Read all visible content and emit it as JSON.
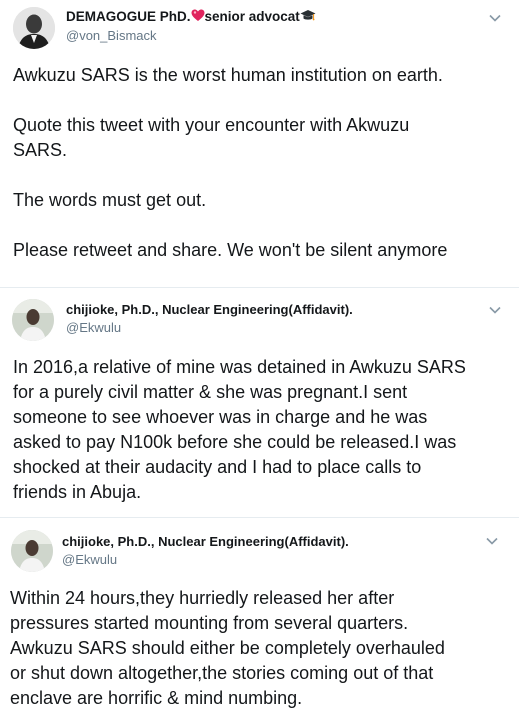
{
  "tweets": [
    {
      "display_name": "DEMAGOGUE PhD.",
      "display_name_suffix": "senior advocat",
      "name_emojis": [
        "heart-icon",
        "graduation-cap-icon"
      ],
      "handle": "@von_Bismack",
      "paragraphs": [
        "Awkuzu SARS is the worst human institution on earth.",
        "Quote this tweet with your encounter with Akwuzu SARS.",
        "The words must get out.",
        "Please retweet and share. We won't be silent anymore"
      ]
    },
    {
      "display_name": "chijioke, Ph.D., Nuclear Engineering(Affidavit).",
      "handle": "@Ekwulu",
      "lines": [
        "In 2016,a relative of mine was detained in Awkuzu SARS",
        "for a purely civil matter & she was pregnant.I sent",
        "someone to see whoever was in charge and he was",
        "asked to pay N100k before she could be released.I was",
        "shocked at their audacity and I had to place calls to",
        "friends in Abuja."
      ]
    },
    {
      "display_name": "chijioke, Ph.D., Nuclear Engineering(Affidavit).",
      "handle": "@Ekwulu",
      "lines": [
        "Within 24 hours,they hurriedly released her after",
        "pressures started mounting from several quarters.",
        "Awkuzu SARS should either be completely overhauled",
        "or shut down altogether,the stories coming out of that",
        "enclave are horrific & mind numbing."
      ]
    }
  ],
  "colors": {
    "text": "#14171a",
    "muted": "#657786",
    "divider": "#e6ecf0",
    "heart": "#e0245e"
  }
}
